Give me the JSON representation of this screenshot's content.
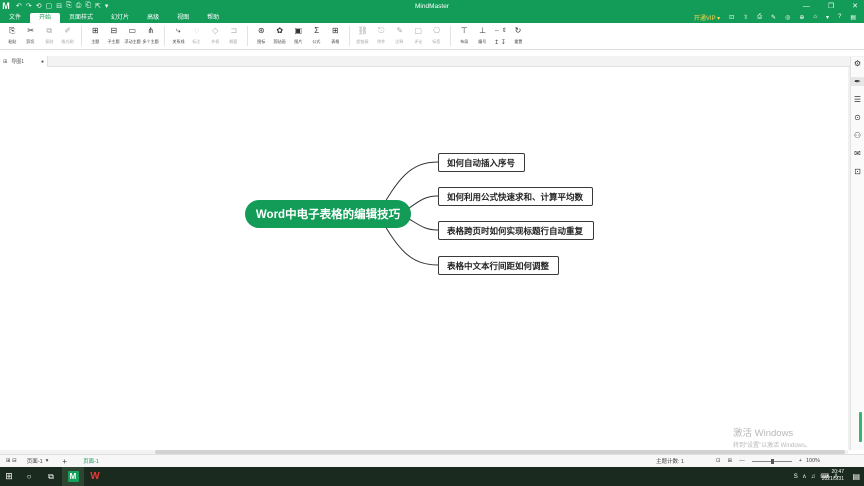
{
  "app": {
    "title": "MindMaster",
    "logo": "M",
    "quick_access": [
      "↶",
      "↷",
      "⟲",
      "▢",
      "⊟",
      "⎘",
      "⎙",
      "⎗",
      "⇱",
      "▾"
    ],
    "window_controls": [
      "—",
      "❐",
      "✕"
    ]
  },
  "menu": {
    "tabs": [
      {
        "label": "文件",
        "active": false
      },
      {
        "label": "开始",
        "active": true
      },
      {
        "label": "页面样式",
        "active": false
      },
      {
        "label": "幻灯片",
        "active": false
      },
      {
        "label": "高级",
        "active": false
      },
      {
        "label": "视图",
        "active": false
      },
      {
        "label": "帮助",
        "active": false
      }
    ],
    "vip": "开通VIP ▾",
    "right_icons": [
      "⊡",
      "⇧",
      "⎙",
      "✎",
      "◎",
      "⊕",
      "⌂",
      "▾",
      "?",
      "▤"
    ]
  },
  "ribbon": {
    "group1": [
      {
        "icon": "⎘",
        "label": "粘贴",
        "dim": false
      },
      {
        "icon": "✂",
        "label": "剪切",
        "dim": false
      },
      {
        "icon": "⧉",
        "label": "复制",
        "dim": true
      },
      {
        "icon": "✐",
        "label": "格式刷",
        "dim": true
      }
    ],
    "group2": [
      {
        "icon": "⊞",
        "label": "主题",
        "dim": false
      },
      {
        "icon": "⊟",
        "label": "子主题",
        "dim": false
      },
      {
        "icon": "▭",
        "label": "浮动主题",
        "dim": false
      },
      {
        "icon": "⋔",
        "label": "多个主题",
        "dim": false
      }
    ],
    "group3": [
      {
        "icon": "⤷",
        "label": "关系线",
        "dim": false
      },
      {
        "icon": "◌",
        "label": "标注",
        "dim": true
      },
      {
        "icon": "◇",
        "label": "外框",
        "dim": true
      },
      {
        "icon": "⊐",
        "label": "概要",
        "dim": true
      }
    ],
    "group4": [
      {
        "icon": "⊛",
        "label": "图标",
        "dim": false
      },
      {
        "icon": "✿",
        "label": "剪贴画",
        "dim": false
      },
      {
        "icon": "▣",
        "label": "图片",
        "dim": false
      },
      {
        "icon": "Σ",
        "label": "公式",
        "dim": false
      },
      {
        "icon": "⊞",
        "label": "表格",
        "dim": false
      }
    ],
    "group5": [
      {
        "icon": "⛓",
        "label": "超链接",
        "dim": true
      },
      {
        "icon": "⎋",
        "label": "附件",
        "dim": true
      },
      {
        "icon": "✎",
        "label": "注释",
        "dim": true
      },
      {
        "icon": "▢",
        "label": "评论",
        "dim": true
      },
      {
        "icon": "⎔",
        "label": "标签",
        "dim": true
      }
    ],
    "group6": [
      {
        "icon": "⊤",
        "label": "布局",
        "dim": false
      },
      {
        "icon": "⊥",
        "label": "编号",
        "dim": false
      }
    ],
    "small_group": [
      "⇔ ⇕",
      "↥ ↧"
    ],
    "reset": {
      "icon": "↻",
      "label": "重置"
    }
  },
  "doc_tab": {
    "label": "导图1",
    "icon": "⊞",
    "close": "●"
  },
  "mindmap": {
    "central": "Word中电子表格的编辑技巧",
    "topics": [
      "如何自动插入序号",
      "如何利用公式快速求和、计算平均数",
      "表格跨页时如何实现标题行自动重复",
      "表格中文本行间距如何调整"
    ],
    "line_color": "#333333",
    "central_color": "#139c58"
  },
  "right_panel": [
    "⚙",
    "✒",
    "☰",
    "⊙",
    "⚇",
    "✉",
    "⊡"
  ],
  "watermark": {
    "line1": "激活 Windows",
    "line2": "转到“设置”以激活 Windows。"
  },
  "status": {
    "page": "⊞ ⊟",
    "sheet": "页面-1",
    "add": "+",
    "active_sheet": "页面-1",
    "count": "主题计数: 1",
    "icons": [
      "⊡",
      "⊞",
      "—"
    ],
    "zoom_minus": "—",
    "zoom_plus": "+",
    "zoom_pct": "100%"
  },
  "taskbar": {
    "start": "⊞",
    "search": "○",
    "taskview": "⧉",
    "time": "20:47",
    "date": "2021/5/31",
    "tray": [
      "S",
      "ʌ",
      "♫",
      "⌨",
      "A"
    ],
    "notifications": "▤"
  }
}
